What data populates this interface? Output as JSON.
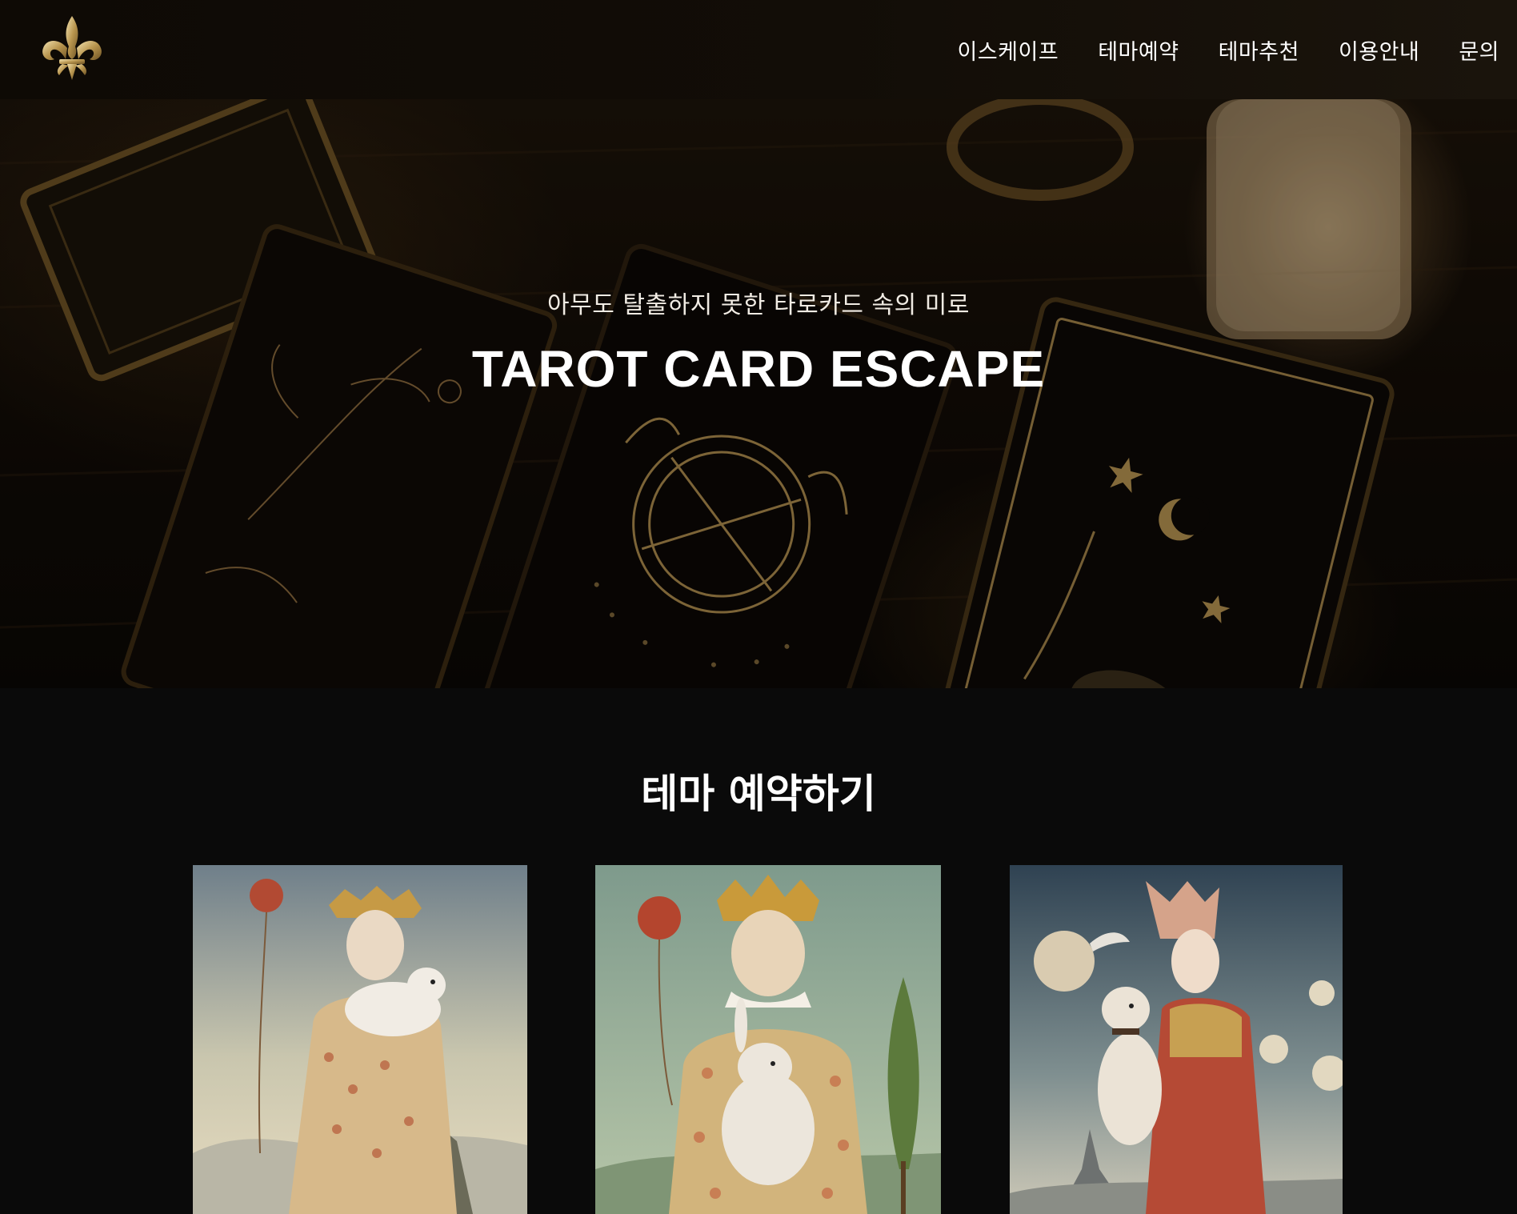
{
  "header": {
    "logo_icon": "fleur-de-lis-icon",
    "nav": [
      "이스케이프",
      "테마예약",
      "테마추천",
      "이용안내",
      "문의"
    ]
  },
  "hero": {
    "subtitle": "아무도 탈출하지 못한 타로카드 속의 미로",
    "title": "TAROT CARD ESCAPE"
  },
  "section": {
    "title": "테마 예약하기"
  },
  "colors": {
    "page_background": "#0a0a0a",
    "gold": "#c9a25a",
    "text": "#ffffff"
  }
}
